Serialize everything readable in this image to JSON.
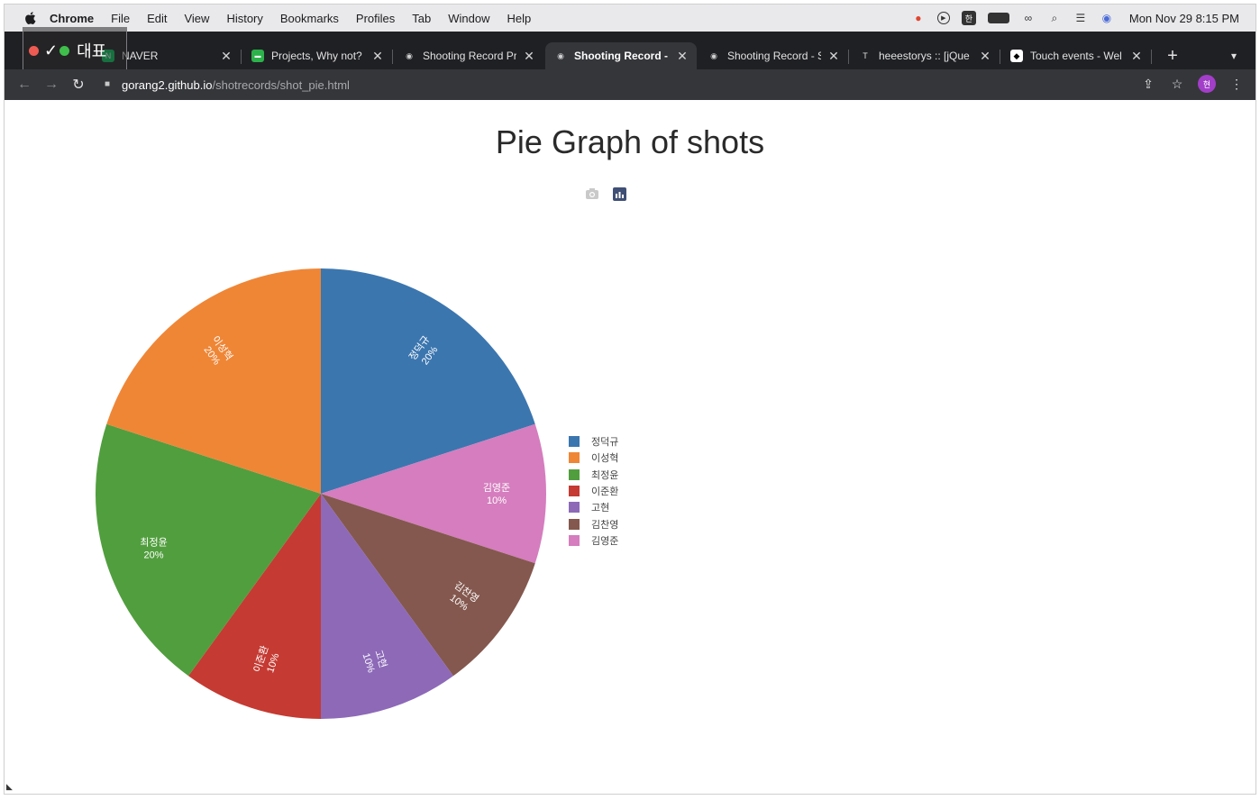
{
  "menubar": {
    "items": [
      "Chrome",
      "File",
      "Edit",
      "View",
      "History",
      "Bookmarks",
      "Profiles",
      "Tab",
      "Window",
      "Help"
    ],
    "clock": "Mon Nov 29  8:15 PM"
  },
  "window_overlay": {
    "label": "대표"
  },
  "tabs": [
    {
      "title": "NAVER",
      "favicon_color": "#03c75a",
      "favicon_glyph": "N",
      "active": false
    },
    {
      "title": "Projects, Why not?",
      "favicon_color": "#2db14b",
      "favicon_glyph": "▬",
      "active": false
    },
    {
      "title": "Shooting Record Pr",
      "favicon_color": "#cfcfd1",
      "favicon_glyph": "◉",
      "active": false
    },
    {
      "title": "Shooting Record - S",
      "favicon_color": "#cfcfd1",
      "favicon_glyph": "◉",
      "active": true
    },
    {
      "title": "Shooting Record - S",
      "favicon_color": "#cfcfd1",
      "favicon_glyph": "◉",
      "active": false
    },
    {
      "title": "heeestorys :: [jQue",
      "favicon_color": "#1f2023",
      "favicon_glyph": "T",
      "active": false
    },
    {
      "title": "Touch events - Wel",
      "favicon_color": "#ffffff",
      "favicon_glyph": "◆",
      "active": false
    }
  ],
  "address": {
    "host": "gorang2.github.io",
    "path": "/shotrecords/shot_pie.html"
  },
  "profile_initial": "현",
  "page": {
    "title": "Pie Graph of shots",
    "corner_glyph": "◣"
  },
  "colors": {
    "chrome_dark": "#1f2023",
    "toolbar": "#35363a",
    "active_tab_text": "#ffffff"
  },
  "chart_data": {
    "type": "pie",
    "title": "Pie Graph of shots",
    "legend_position": "right",
    "slices": [
      {
        "label": "정덕규",
        "percent": 20,
        "color": "#3b76af"
      },
      {
        "label": "이성혁",
        "percent": 20,
        "color": "#ef8636"
      },
      {
        "label": "최정윤",
        "percent": 20,
        "color": "#519e3e"
      },
      {
        "label": "이준환",
        "percent": 10,
        "color": "#c53a32"
      },
      {
        "label": "고현",
        "percent": 10,
        "color": "#8d69b8"
      },
      {
        "label": "김찬영",
        "percent": 10,
        "color": "#84584e"
      },
      {
        "label": "김영준",
        "percent": 10,
        "color": "#d57dbe"
      }
    ],
    "slice_order_clockwise_from_top": [
      "정덕규",
      "김영준",
      "김찬영",
      "고현",
      "이준환",
      "최정윤",
      "이성혁"
    ],
    "percent_labels": {
      "정덕규": "20%",
      "이성혁": "20%",
      "최정윤": "20%",
      "이준환": "10%",
      "고현": "10%",
      "김찬영": "10%",
      "김영준": "10%"
    }
  }
}
